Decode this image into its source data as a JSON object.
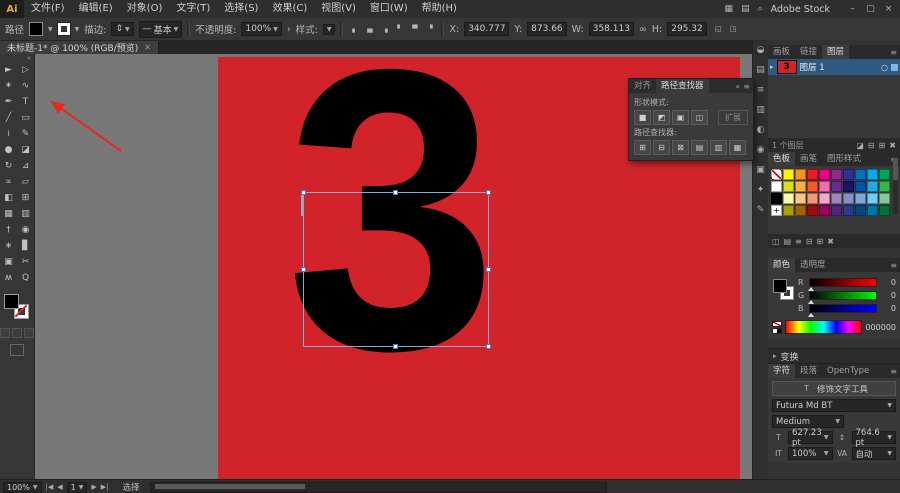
{
  "app": {
    "logo": "Ai",
    "window_controls": {
      "minimize": "–",
      "maximize": "▢",
      "close": "×"
    }
  },
  "menu": {
    "items": [
      {
        "label": "文件(F)"
      },
      {
        "label": "编辑(E)"
      },
      {
        "label": "对象(O)"
      },
      {
        "label": "文字(T)"
      },
      {
        "label": "选择(S)"
      },
      {
        "label": "效果(C)"
      },
      {
        "label": "视图(V)"
      },
      {
        "label": "窗口(W)"
      },
      {
        "label": "帮助(H)"
      }
    ],
    "right": {
      "arrange_icon": "▦",
      "workspace_icon": "▤",
      "search_icon": "⌕",
      "search_label": "Adobe Stock"
    }
  },
  "control": {
    "object_label": "路径",
    "stroke_label": "描边:",
    "stroke_stepper": "⇕",
    "profile_dash": "—",
    "profile": "基本",
    "opacity_label": "不透明度:",
    "opacity": "100%",
    "opacity_more": "›",
    "style_label": "样式:",
    "align_icons": [
      {
        "name": "align-left-icon",
        "glyph": "▖"
      },
      {
        "name": "align-center-h-icon",
        "glyph": "▄"
      },
      {
        "name": "align-right-icon",
        "glyph": "▗"
      },
      {
        "name": "align-top-icon",
        "glyph": "▘"
      },
      {
        "name": "align-middle-icon",
        "glyph": "▀"
      },
      {
        "name": "align-bottom-icon",
        "glyph": "▝"
      }
    ],
    "x_label": "X:",
    "x": "340.777",
    "y_label": "Y:",
    "y": "873.66",
    "w_label": "W:",
    "w": "358.113",
    "link_icon": "∞",
    "h_label": "H:",
    "h": "295.32",
    "extra_icons": [
      {
        "name": "transform-panel-icon",
        "glyph": "◱"
      },
      {
        "name": "isolate-selection-icon",
        "glyph": "◳"
      }
    ]
  },
  "doc_tab": {
    "title": "未标题-1* @ 100% (RGB/预览)",
    "close": "✕"
  },
  "toolbar": {
    "collapse": "«",
    "tools": [
      {
        "name": "selection-tool",
        "glyph": "►"
      },
      {
        "name": "direct-selection-tool",
        "glyph": "▷"
      },
      {
        "name": "magic-wand-tool",
        "glyph": "✶"
      },
      {
        "name": "lasso-tool",
        "glyph": "∿"
      },
      {
        "name": "pen-tool",
        "glyph": "✒"
      },
      {
        "name": "type-tool",
        "glyph": "T"
      },
      {
        "name": "line-segment-tool",
        "glyph": "╱"
      },
      {
        "name": "rectangle-tool",
        "glyph": "▭"
      },
      {
        "name": "paintbrush-tool",
        "glyph": "≀"
      },
      {
        "name": "pencil-tool",
        "glyph": "✎"
      },
      {
        "name": "blob-brush-tool",
        "glyph": "●"
      },
      {
        "name": "eraser-tool",
        "glyph": "◪"
      },
      {
        "name": "rotate-tool",
        "glyph": "↻"
      },
      {
        "name": "scale-tool",
        "glyph": "⊿"
      },
      {
        "name": "width-tool",
        "glyph": "∝"
      },
      {
        "name": "free-transform-tool",
        "glyph": "▱"
      },
      {
        "name": "shape-builder-tool",
        "glyph": "◧"
      },
      {
        "name": "perspective-grid-tool",
        "glyph": "⊞"
      },
      {
        "name": "mesh-tool",
        "glyph": "▦"
      },
      {
        "name": "gradient-tool",
        "glyph": "▥"
      },
      {
        "name": "eyedropper-tool",
        "glyph": "†"
      },
      {
        "name": "blend-tool",
        "glyph": "◉"
      },
      {
        "name": "symbol-sprayer-tool",
        "glyph": "∗"
      },
      {
        "name": "column-graph-tool",
        "glyph": "▊"
      },
      {
        "name": "artboard-tool",
        "glyph": "▣"
      },
      {
        "name": "slice-tool",
        "glyph": "✂"
      },
      {
        "name": "hand-tool",
        "glyph": "ʍ"
      },
      {
        "name": "zoom-tool",
        "glyph": "Q"
      }
    ]
  },
  "canvas": {
    "numeral": "3"
  },
  "pathfinder": {
    "tabs": [
      {
        "label": "对齐"
      },
      {
        "label": "路径查找器"
      }
    ],
    "head_icons": {
      "collapse": "«",
      "menu": "≡"
    },
    "shape_label": "形状模式:",
    "pf_label": "路径查找器:",
    "expand": "扩展",
    "shape_buttons": [
      {
        "name": "unite-icon",
        "glyph": "■"
      },
      {
        "name": "minus-front-icon",
        "glyph": "◩"
      },
      {
        "name": "intersect-icon",
        "glyph": "▣"
      },
      {
        "name": "exclude-icon",
        "glyph": "◫"
      }
    ],
    "pf_buttons": [
      {
        "name": "divide-icon",
        "glyph": "⊞"
      },
      {
        "name": "trim-icon",
        "glyph": "⊟"
      },
      {
        "name": "merge-icon",
        "glyph": "⊠"
      },
      {
        "name": "crop-icon",
        "glyph": "▤"
      },
      {
        "name": "outline-icon",
        "glyph": "▥"
      },
      {
        "name": "minus-back-icon",
        "glyph": "▦"
      }
    ]
  },
  "dock": {
    "icons": [
      {
        "name": "color-panel-icon",
        "glyph": "◒"
      },
      {
        "name": "color-guide-panel-icon",
        "glyph": "▤"
      },
      {
        "name": "stroke-panel-icon",
        "glyph": "≡"
      },
      {
        "name": "gradient-panel-icon",
        "glyph": "▥"
      },
      {
        "name": "transparency-panel-icon",
        "glyph": "◐"
      },
      {
        "name": "appearance-panel-icon",
        "glyph": "◉"
      },
      {
        "name": "graphic-styles-panel-icon",
        "glyph": "▣"
      },
      {
        "name": "symbols-panel-icon",
        "glyph": "✦"
      },
      {
        "name": "brushes-panel-icon",
        "glyph": "✎"
      }
    ]
  },
  "layers": {
    "tabs": [
      "画板",
      "链接",
      "图层"
    ],
    "menu_icon": "≡",
    "row": {
      "expander": "▸",
      "thumb_char": "3",
      "name": "图层 1",
      "target": "○"
    },
    "footer": {
      "count": "1 个图层",
      "icons": [
        {
          "name": "make-clip-mask-icon",
          "glyph": "◪"
        },
        {
          "name": "new-sublayer-icon",
          "glyph": "⊟"
        },
        {
          "name": "new-layer-icon",
          "glyph": "⊞"
        },
        {
          "name": "delete-layer-icon",
          "glyph": "✖"
        }
      ]
    }
  },
  "swatches": {
    "tabs": [
      "色板",
      "画笔",
      "图形样式"
    ],
    "menu_icon": "≡",
    "cells": [
      {
        "cls": "sw none",
        "c": "#ffffff"
      },
      {
        "cls": "sw",
        "c": "#fff200"
      },
      {
        "cls": "sw",
        "c": "#f7941d"
      },
      {
        "cls": "sw",
        "c": "#ed1c24"
      },
      {
        "cls": "sw",
        "c": "#ec008c"
      },
      {
        "cls": "sw",
        "c": "#92278f"
      },
      {
        "cls": "sw",
        "c": "#2e3192"
      },
      {
        "cls": "sw",
        "c": "#0072bc"
      },
      {
        "cls": "sw",
        "c": "#00aeef"
      },
      {
        "cls": "sw",
        "c": "#00a651"
      },
      {
        "cls": "sw",
        "c": "#ffffff"
      },
      {
        "cls": "sw",
        "c": "#d9e021"
      },
      {
        "cls": "sw",
        "c": "#fbb040"
      },
      {
        "cls": "sw",
        "c": "#f15a29"
      },
      {
        "cls": "sw",
        "c": "#f06eaa"
      },
      {
        "cls": "sw",
        "c": "#662d91"
      },
      {
        "cls": "sw",
        "c": "#1b1464"
      },
      {
        "cls": "sw",
        "c": "#0054a6"
      },
      {
        "cls": "sw",
        "c": "#27aae1"
      },
      {
        "cls": "sw",
        "c": "#39b54a"
      },
      {
        "cls": "sw",
        "c": "#000000"
      },
      {
        "cls": "sw",
        "c": "#fff9ae"
      },
      {
        "cls": "sw",
        "c": "#fdc689"
      },
      {
        "cls": "sw",
        "c": "#f69679"
      },
      {
        "cls": "sw",
        "c": "#f5a9d0"
      },
      {
        "cls": "sw",
        "c": "#a186be"
      },
      {
        "cls": "sw",
        "c": "#8393ca"
      },
      {
        "cls": "sw",
        "c": "#7da7d8"
      },
      {
        "cls": "sw",
        "c": "#6dcff6"
      },
      {
        "cls": "sw",
        "c": "#82ca9c"
      },
      {
        "cls": "sw reg",
        "c": "#ffffff"
      },
      {
        "cls": "sw",
        "c": "#aba000"
      },
      {
        "cls": "sw",
        "c": "#a36209"
      },
      {
        "cls": "sw",
        "c": "#9e0b0f"
      },
      {
        "cls": "sw",
        "c": "#9e005d"
      },
      {
        "cls": "sw",
        "c": "#52247f"
      },
      {
        "cls": "sw",
        "c": "#2b3990"
      },
      {
        "cls": "sw",
        "c": "#004a80"
      },
      {
        "cls": "sw",
        "c": "#0076a3"
      },
      {
        "cls": "sw",
        "c": "#007236"
      }
    ],
    "footer_icons": [
      {
        "name": "swatch-libraries-icon",
        "glyph": "◫"
      },
      {
        "name": "swatch-kinds-icon",
        "glyph": "▤"
      },
      {
        "name": "swatch-options-icon",
        "glyph": "≡"
      },
      {
        "name": "new-color-group-icon",
        "glyph": "⊟"
      },
      {
        "name": "new-swatch-icon",
        "glyph": "⊞"
      },
      {
        "name": "delete-swatch-icon",
        "glyph": "✖"
      }
    ]
  },
  "color": {
    "tabs": [
      "颜色",
      "透明度"
    ],
    "menu_icon": "≡",
    "sliders": [
      {
        "ch": "R",
        "value": "0",
        "cls": "track r"
      },
      {
        "ch": "G",
        "value": "0",
        "cls": "track g"
      },
      {
        "ch": "B",
        "value": "0",
        "cls": "track b"
      }
    ],
    "hex": "000000"
  },
  "transform": {
    "icon": "▸",
    "label": "变换"
  },
  "character": {
    "tabs": [
      "字符",
      "段落",
      "OpenType"
    ],
    "menu_icon": "≡",
    "touch": "修饰文字工具",
    "touch_icon": "T",
    "font": "Futura Md BT",
    "style": "Medium",
    "size_icon": "T",
    "size": "627.23 pt",
    "leading_icon": "↕",
    "leading": "764.6 pt",
    "vscale_icon": "IT",
    "vscale": "100%",
    "kern_icon": "VA",
    "kerning": "自动"
  },
  "status": {
    "zoom": "100%",
    "nav_first": "|◀",
    "nav_prev": "◀",
    "artboard": "1",
    "nav_next": "▶",
    "nav_last": "▶|",
    "label": "选择"
  },
  "colors": {
    "artboard_red": "#d2232b",
    "selection_blue": "#8aa9d6",
    "annotation_red": "#e8281e"
  }
}
